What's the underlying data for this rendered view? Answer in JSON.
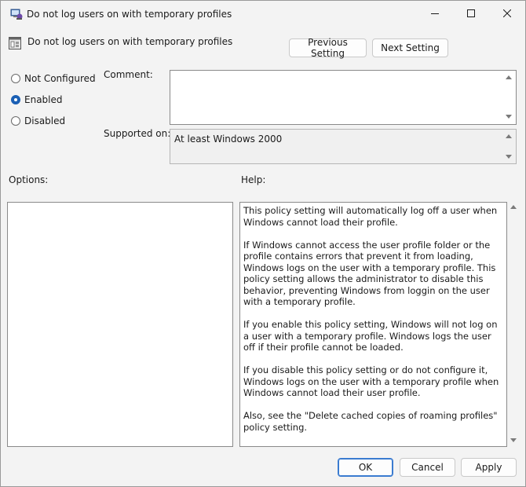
{
  "window": {
    "title": "Do not log users on with temporary profiles"
  },
  "header": {
    "title": "Do not log users on with temporary profiles"
  },
  "nav": {
    "previous": "Previous Setting",
    "next": "Next Setting"
  },
  "state": {
    "options": [
      {
        "label": "Not Configured",
        "selected": false
      },
      {
        "label": "Enabled",
        "selected": true
      },
      {
        "label": "Disabled",
        "selected": false
      }
    ]
  },
  "comment": {
    "label": "Comment:",
    "value": ""
  },
  "supported": {
    "label": "Supported on:",
    "value": "At least Windows 2000"
  },
  "options_label": "Options:",
  "help": {
    "label": "Help:",
    "paragraphs": [
      "This policy setting will automatically log off a user when Windows cannot load their profile.",
      "If Windows cannot access the user profile folder or the profile contains errors that prevent it from loading, Windows logs on the user with a temporary profile. This policy setting allows the administrator to disable this behavior, preventing Windows from loggin on the user with a temporary profile.",
      "If you enable this policy setting, Windows will not log on a user with a temporary profile. Windows logs the user off if their profile cannot be loaded.",
      "If you disable this policy setting or do not configure it, Windows logs on the user with a temporary profile when Windows cannot load their user profile.",
      "Also, see the \"Delete cached copies of roaming profiles\" policy setting."
    ]
  },
  "footer": {
    "ok": "OK",
    "cancel": "Cancel",
    "apply": "Apply"
  },
  "colors": {
    "accent": "#1a5fb4",
    "window_bg": "#f3f3f3"
  }
}
